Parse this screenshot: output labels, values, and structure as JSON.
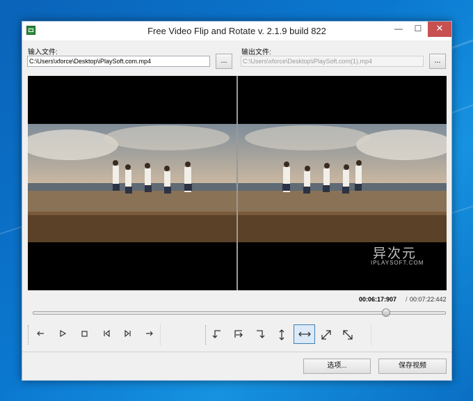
{
  "window": {
    "title": "Free Video Flip and Rotate  v. 2.1.9 build 822",
    "minimize_glyph": "—",
    "maximize_glyph": "☐",
    "close_glyph": "✕"
  },
  "input": {
    "label": "输入文件:",
    "path": "C:\\Users\\xforce\\Desktop\\iPlaySoft.com.mp4",
    "browse_label": "..."
  },
  "output": {
    "label": "输出文件:",
    "path": "C:\\Users\\xforce\\Desktop\\iPlaySoft.com(1).mp4",
    "browse_label": "..."
  },
  "watermark": {
    "title": "异次元",
    "subtitle": "IPLAYSOFT.COM"
  },
  "playback": {
    "current_time": "00:06:17:907",
    "separator": "/",
    "total_time": "00:07:22:442",
    "progress_fraction": 0.856
  },
  "controls": {
    "transport": [
      "prev-frame-icon",
      "play-icon",
      "stop-icon",
      "skip-start-icon",
      "skip-end-icon",
      "next-frame-icon"
    ],
    "transform": [
      "rotate-left-icon",
      "rotate-right-icon",
      "rotate-down-icon",
      "flip-vertical-icon",
      "flip-horizontal-icon",
      "transpose-icon",
      "transverse-icon"
    ],
    "active_transform": "flip-horizontal-icon"
  },
  "buttons": {
    "options": "选项...",
    "save": "保存视频"
  },
  "colors": {
    "close_button": "#c75050",
    "active_button_border": "#3c7fb1",
    "desktop": "#0b78d0"
  }
}
